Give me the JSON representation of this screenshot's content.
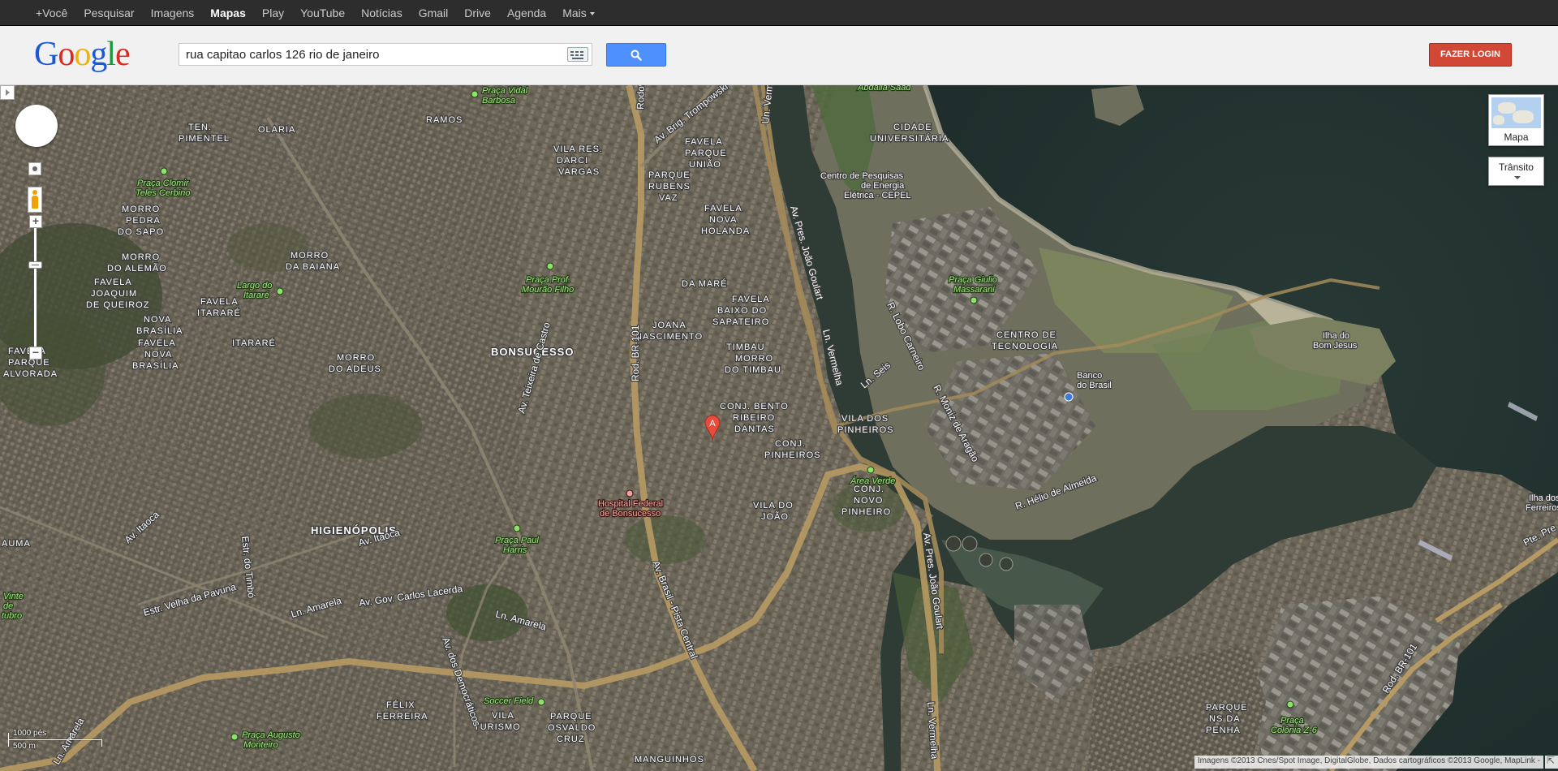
{
  "topbar": {
    "items": [
      {
        "label": "+Você"
      },
      {
        "label": "Pesquisar"
      },
      {
        "label": "Imagens"
      },
      {
        "label": "Mapas",
        "active": true
      },
      {
        "label": "Play"
      },
      {
        "label": "YouTube"
      },
      {
        "label": "Notícias"
      },
      {
        "label": "Gmail"
      },
      {
        "label": "Drive"
      },
      {
        "label": "Agenda"
      },
      {
        "label": "Mais"
      }
    ]
  },
  "header": {
    "logo": {
      "letters": [
        "G",
        "o",
        "o",
        "g",
        "l",
        "e"
      ]
    },
    "search": {
      "value": "rua capitao carlos 126 rio de janeiro"
    },
    "search_icon": "search-icon",
    "login_label": "FAZER LOGIN",
    "colors": {
      "search_button": "#4d90fe",
      "login_button": "#d14836"
    }
  },
  "map": {
    "view": "satellite",
    "controls": {
      "map_type_label": "Mapa",
      "traffic_label": "Trânsito"
    },
    "marker": {
      "label": "A",
      "color": "#e84c3d"
    },
    "scale": {
      "imperial": "1000 pés",
      "metric": "500 m"
    },
    "copyright": "Imagens ©2013 Cnes/Spot Image, DigitalGlobe, Dados cartográficos ©2013 Google, MapLink -",
    "labels": {
      "neighborhoods": {
        "ramos": "RAMOS",
        "olaria": "OLARIA",
        "tenpimentel": "TEN.",
        "tenpimentel2": "PIMENTEL",
        "morropedra": "MORRO",
        "morropedra2": "PEDRA",
        "morropedra3": "DO SAPO",
        "morroalemao": "MORRO",
        "morroalemao2": "DO ALEMÃO",
        "morrobaiana": "MORRO",
        "morrobaiana2": "DA BAIANA",
        "favelajoaquim": "FAVELA",
        "favelajoaquim2": "JOAQUIM",
        "favelajoaquim3": "DE QUEIROZ",
        "favelaitarare": "FAVELA",
        "favelaitarare2": "ITARARÉ",
        "novabrasilia": "NOVA",
        "novabrasilia2": "BRASÍLIA",
        "favelanovabr": "FAVELA",
        "favelanovabr2": "NOVA",
        "favelanovabr3": "BRASÍLIA",
        "favelaparque": "FAVELA",
        "favelaparque2": "PARQUE",
        "favelaparque3": "ALVORADA",
        "itarare": "ITARARÉ",
        "morroadeus": "MORRO",
        "morroadeus2": "DO ADEUS",
        "bonsucesso": "BONSUCESSO",
        "vilares": "VILA RES.",
        "vilares2": "DARCI",
        "vilares3": "VARGAS",
        "favelaparqueuniao": "FAVELA",
        "favelaparqueuniao2": "PARQUE",
        "favelaparqueuniao3": "UNIÃO",
        "parquerubens": "PARQUE",
        "parquerubens2": "RUBENS",
        "parquerubens3": "VAZ",
        "favelanovaholanda": "FAVELA",
        "favelanovaholanda2": "NOVA",
        "favelanovaholanda3": "HOLANDA",
        "maré": "DA MARÉ",
        "baixosapateiro": "FAVELA",
        "baixosapateiro2": "BAIXO DO",
        "baixosapateiro3": "SAPATEIRO",
        "joananascimento": "JOANA",
        "joananascimento2": "NASCIMENTO",
        "timbau": "TIMBAU",
        "morrotimbau": "MORRO",
        "morrotimbau2": "DO TIMBAU",
        "conjbento": "CONJ. BENTO",
        "conjbento2": "RIBEIRO",
        "conjbento3": "DANTAS",
        "vilapinheiros": "VILA DOS",
        "vilapinheiros2": "PINHEIROS",
        "conjpinheiros": "CONJ.",
        "conjpinheiros2": "PINHEIROS",
        "conjnovo": "CONJ.",
        "conjnovo2": "NOVO",
        "conjnovo3": "PINHEIRO",
        "vilajoao": "VILA DO",
        "vilajoao2": "JOÃO",
        "higienopolis": "HIGIENÓPOLIS",
        "vilafelicia": "VILA",
        "vilafelicia2": "TURISMO",
        "felixferreira": "FÉLIX",
        "felixferreira2": "FERREIRA",
        "parqueosvaldo": "PARQUE",
        "parqueosvaldo2": "OSVALDO",
        "parqueosvaldo3": "CRUZ",
        "manguinhos": "MANGUINHOS",
        "cidadeuniv": "CIDADE",
        "cidadeuniv2": "UNIVERSITÁRIA",
        "centrotec": "CENTRO DE",
        "centrotec2": "TECNOLOGIA",
        "parquenossa": "PARQUE",
        "parquenossa2": "NS DA",
        "parquenossa3": "PENHA",
        "auma": "AUMA"
      },
      "pois": {
        "pracavidal": "Praça Vidal",
        "pracavidal2": "Barbosa",
        "pracaclomir": "Praça Clomir",
        "pracaclomir2": "Teles Cerbino",
        "largoitarare": "Largo do",
        "largoitarare2": "Itararé",
        "pracamourao": "Praça Prof.",
        "pracamourao2": "Mourão Filho",
        "pracagiulio": "Praça Giulio",
        "pracagiulio2": "Massarani",
        "pracapaul": "Praça Paul",
        "pracapaul2": "Harris",
        "areaverde": "Área Verde",
        "soccerfield": "Soccer Field",
        "pracaaugusto": "Praça Augusto",
        "pracaaugusto2": "Monteiro",
        "pracacolonia": "Praça",
        "pracacolonia2": "Colônia Z-6",
        "vinte": "Vinte",
        "vinte2": "de",
        "vinte3": "tubro",
        "cepel": "Centro de Pesquisas",
        "cepel2": "de Energia",
        "cepel3": "Elétrica - CEPEL",
        "bancobrasil": "Banco",
        "bancobrasil2": "do Brasil",
        "ilhabomjesus": "Ilha do",
        "ilhabomjesus2": "Bom Jesus",
        "ilhaferreiros": "Ilha dos",
        "ilhaferreiros2": "Ferreiros",
        "abdalla": "Abdalla Saad",
        "hospital": "Hospital Federal",
        "hospital2": "de Bonsucesso"
      },
      "roads": {
        "br101": "Rod. BR-101",
        "br101b": "Rodovia BR-101",
        "brigtrompowski": "Av. Brig. Trompowski",
        "presjoaogoulart": "Av. Pres. João Goulart",
        "presjoaogoulart2": "Av. Pres. João Goulart",
        "linhavermelha": "Ln. Vermelha",
        "linhavermelha2": "Ln. Vermelha",
        "linhavermelha3": "Ln. Vermelha",
        "linhavermelha4": "Un. Verme",
        "teixeiracastro": "Av. Teixeira de Castro",
        "itaoca": "Av. Itaoca",
        "itaoca2": "Av. Itaoca",
        "estradadotimbo": "Estr. do Timbó",
        "velhapavuna": "Estr. Velha da Pavuna",
        "amarela": "Ln. Amarela",
        "amarela2": "Ln. Amarela",
        "amarela3": "Ln. Amarela",
        "carloslacerda": "Av. Gov. Carlos Lacerda",
        "democraticos": "Av. dos Democráticos",
        "brasil": "Av. Brasil - Pista Central",
        "lobocarneiro": "R. Lobo Carneiro",
        "moniz": "R. Moniz de Aragão",
        "helio": "R. Hélio de Almeida",
        "ptepre": "Pte. Pre",
        "lnseis": "Ln. Seis"
      }
    }
  }
}
